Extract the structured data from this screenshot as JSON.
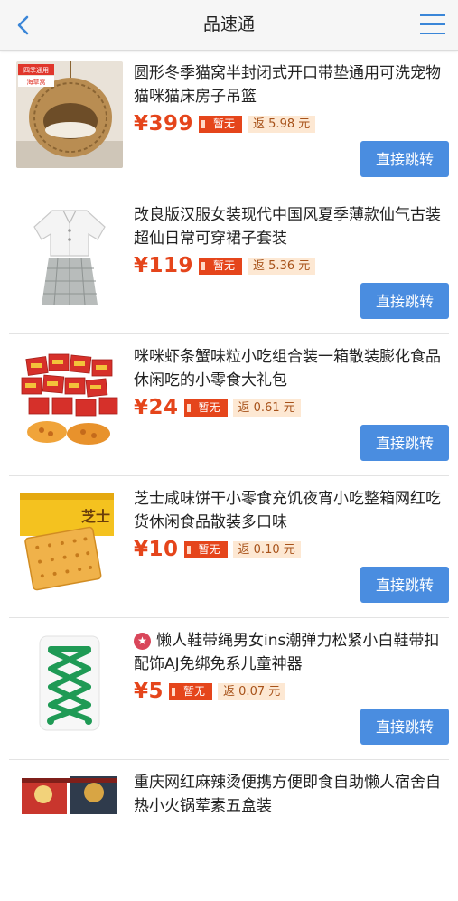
{
  "header": {
    "title": "品速通",
    "accent": "#3a86d8"
  },
  "common": {
    "tag_label": "暂无",
    "button_label": "直接跳转",
    "price_color": "#e5451b",
    "button_color": "#4a8de0"
  },
  "items": [
    {
      "name": "圆形冬季猫窝半封闭式开口带垫通用可洗宠物猫咪猫床房子吊篮",
      "price": "¥399",
      "rebate": "返 5.98 元",
      "thumb_label": "四季通用",
      "thumb_label2": "海草窝"
    },
    {
      "name": "改良版汉服女装现代中国风夏季薄款仙气古装超仙日常可穿裙子套装",
      "price": "¥119",
      "rebate": "返 5.36 元"
    },
    {
      "name": "咪咪虾条蟹味粒小吃组合装一箱散装膨化食品休闲吃的小零食大礼包",
      "price": "¥24",
      "rebate": "返 0.61 元"
    },
    {
      "name": "芝士咸味饼干小零食充饥夜宵小吃整箱网红吃货休闲食品散装多口味",
      "price": "¥10",
      "rebate": "返 0.10 元",
      "thumb_label": "芝士"
    },
    {
      "name": "懒人鞋带绳男女ins潮弹力松紧小白鞋带扣配饰AJ免绑免系儿童神器",
      "price": "¥5",
      "rebate": "返 0.07 元",
      "star_icon": "star-icon"
    },
    {
      "name": "重庆网红麻辣烫便携方便即食自助懒人宿舍自热小火锅荤素五盒装"
    }
  ]
}
